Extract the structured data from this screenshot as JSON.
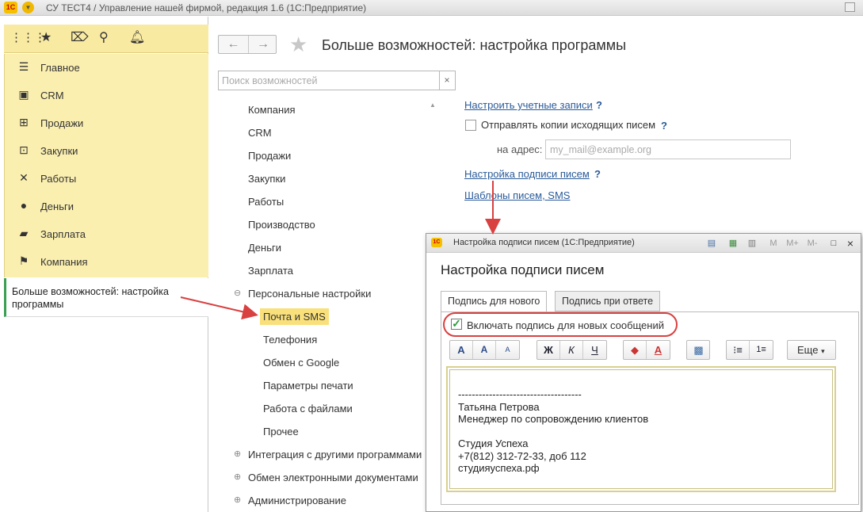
{
  "window": {
    "title": "СУ ТЕСТ4 / Управление нашей фирмой, редакция 1.6  (1С:Предприятие)",
    "logo": "1С"
  },
  "toolbar": {
    "icons": [
      "apps-grid-icon",
      "star-icon",
      "history-icon",
      "search-icon",
      "bell-icon"
    ]
  },
  "sections": [
    {
      "label": "Главное",
      "icon": "menu-lines-icon"
    },
    {
      "label": "CRM",
      "icon": "crm-card-icon"
    },
    {
      "label": "Продажи",
      "icon": "shopping-basket-icon"
    },
    {
      "label": "Закупки",
      "icon": "cart-icon"
    },
    {
      "label": "Работы",
      "icon": "tools-icon"
    },
    {
      "label": "Деньги",
      "icon": "ruble-coin-icon"
    },
    {
      "label": "Зарплата",
      "icon": "wallet-icon"
    },
    {
      "label": "Компания",
      "icon": "flag-icon"
    }
  ],
  "open_windows": [
    {
      "label": "Больше возможностей: настройка программы"
    }
  ],
  "page": {
    "title": "Больше возможностей: настройка программы",
    "search_placeholder": "Поиск возможностей",
    "search_clear": "×"
  },
  "tree": {
    "items": [
      "Компания",
      "CRM",
      "Продажи",
      "Закупки",
      "Работы",
      "Производство",
      "Деньги",
      "Зарплата",
      "Персональные настройки"
    ],
    "children": [
      "Почта и SMS",
      "Телефония",
      "Обмен с Google",
      "Параметры печати",
      "Работа с файлами",
      "Прочее"
    ],
    "collapsed": [
      "Интеграция с другими программами",
      "Обмен электронными документами",
      "Администрирование"
    ],
    "selected": "Почта и SMS"
  },
  "settings": {
    "accounts_link": "Настроить учетные записи",
    "copy_label": "Отправлять копии исходящих писем",
    "copy_checked": false,
    "address_label": "на адрес:",
    "address_placeholder": "my_mail@example.org",
    "signature_link": "Настройка подписи писем",
    "templates_link": "Шаблоны писем, SMS",
    "help": "?"
  },
  "dialog": {
    "title": "Настройка подписи писем  (1С:Предприятие)",
    "heading": "Настройка подписи писем",
    "tabs": [
      "Подпись для нового",
      "Подпись при ответе"
    ],
    "active_tab": 0,
    "include_label": "Включать подпись для новых сообщений",
    "include_checked": true,
    "format_buttons": {
      "font": [
        "A",
        "A",
        "A"
      ],
      "style": [
        "Ж",
        "К",
        "Ч"
      ],
      "color": [
        "fill-color-icon",
        "A"
      ],
      "insert": [
        "insert-image-icon"
      ],
      "lists": [
        "bullet-list-icon",
        "numbered-list-icon"
      ]
    },
    "more_label": "Еще",
    "signature_text": "------------------------------------\nТатьяна Петрова\nМенеджер по сопровождению клиентов\n\nСтудия Успеха\n+7(812) 312-72-33, доб 112\nстудияуспеха.рф",
    "title_buttons": [
      "M",
      "M+",
      "M-"
    ]
  },
  "colors": {
    "accent_yellow": "#fbefb0",
    "selected_item": "#f9e07b",
    "link": "#2a5b9a",
    "annotation_red": "#d94040",
    "check_green": "#2b9a3a"
  }
}
